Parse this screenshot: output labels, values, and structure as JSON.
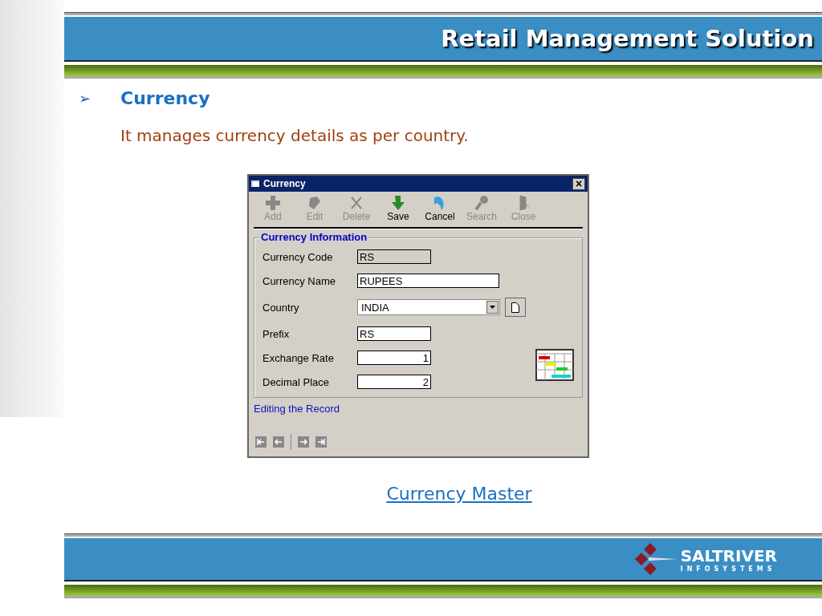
{
  "header": {
    "title": "Retail Management Solution"
  },
  "section": {
    "bullet": "➢",
    "heading": "Currency",
    "description": "It manages currency details as per country."
  },
  "window": {
    "title": "Currency",
    "close": "×",
    "toolbar": [
      {
        "label": "Add",
        "kind": "add",
        "disabled": true
      },
      {
        "label": "Edit",
        "kind": "edit",
        "disabled": true
      },
      {
        "label": "Delete",
        "kind": "delete",
        "disabled": true
      },
      {
        "label": "Save",
        "kind": "save",
        "disabled": false
      },
      {
        "label": "Cancel",
        "kind": "cancel",
        "disabled": false
      },
      {
        "label": "Search",
        "kind": "search",
        "disabled": true
      },
      {
        "label": "Close",
        "kind": "close",
        "disabled": true
      }
    ],
    "group_title": "Currency Information",
    "fields": [
      {
        "label": "Currency Code",
        "value": "RS",
        "kind": "readonly"
      },
      {
        "label": "Currency Name",
        "value": "RUPEES",
        "kind": "wide"
      },
      {
        "label": "Country",
        "value": "INDIA",
        "kind": "combo"
      },
      {
        "label": "Prefix",
        "value": "RS",
        "kind": "short"
      },
      {
        "label": "Exchange Rate",
        "value": "1",
        "kind": "number"
      },
      {
        "label": "Decimal Place",
        "value": "2",
        "kind": "number"
      }
    ],
    "status": "Editing the Record"
  },
  "caption_link": "Currency Master",
  "footer": {
    "logo_name": "SALTRIVER",
    "logo_sub": "INFOSYSTEMS"
  }
}
